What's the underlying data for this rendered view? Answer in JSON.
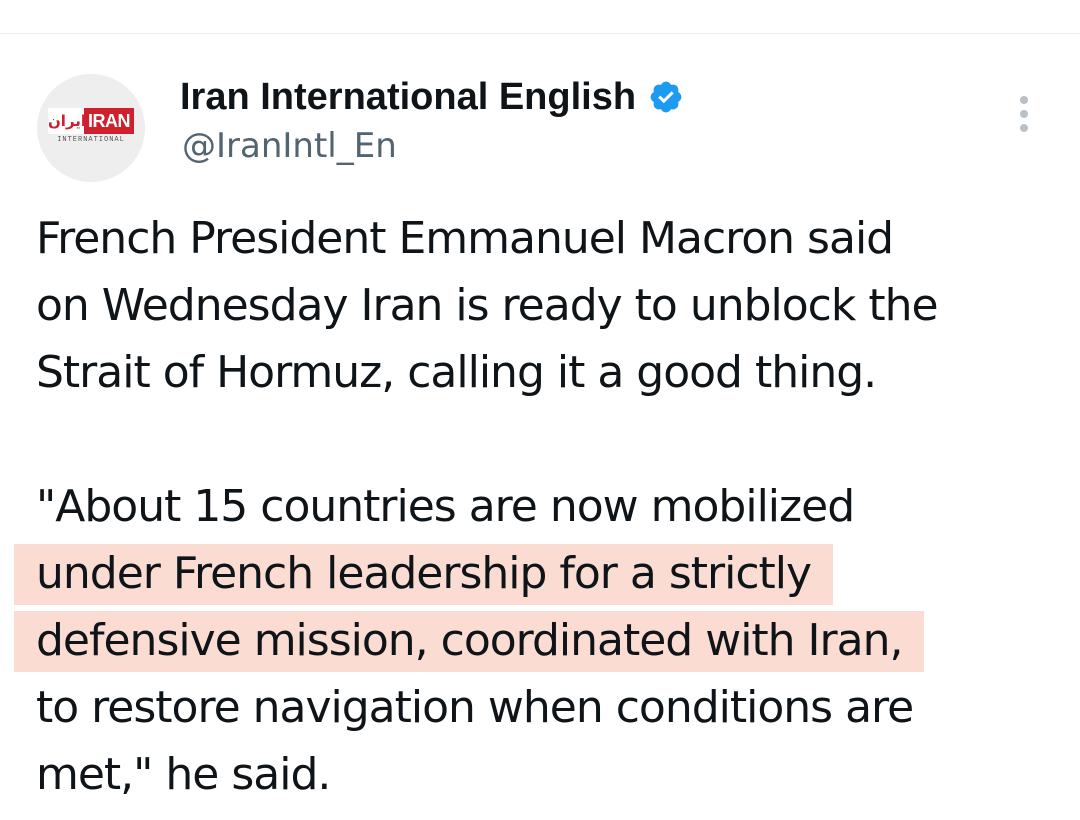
{
  "tweet": {
    "author": {
      "display_name": "Iran International English",
      "handle": "@IranIntl_En",
      "verified": true,
      "verified_icon": "verified-badge-icon",
      "avatar_logo": {
        "farsi_text": "ایران",
        "english_text": "IRAN",
        "subtitle": "INTERNATIONAL"
      }
    },
    "more_icon": "more-options-icon",
    "text_lines": {
      "l1": "French President Emmanuel Macron said",
      "l2": "on Wednesday Iran is ready to unblock the",
      "l3": "Strait of Hormuz, calling it a good thing.",
      "l4": "\"About 15 countries are now mobilized",
      "l5": "under French leadership for a strictly",
      "l6": "defensive mission, coordinated with Iran,",
      "l7": "to restore navigation when conditions are",
      "l8": "met,\" he said."
    }
  },
  "colors": {
    "verified_blue": "#1d9bf0",
    "highlight": "#fbdcd3",
    "secondary_text": "#536471",
    "brand_red": "#d0202e"
  }
}
